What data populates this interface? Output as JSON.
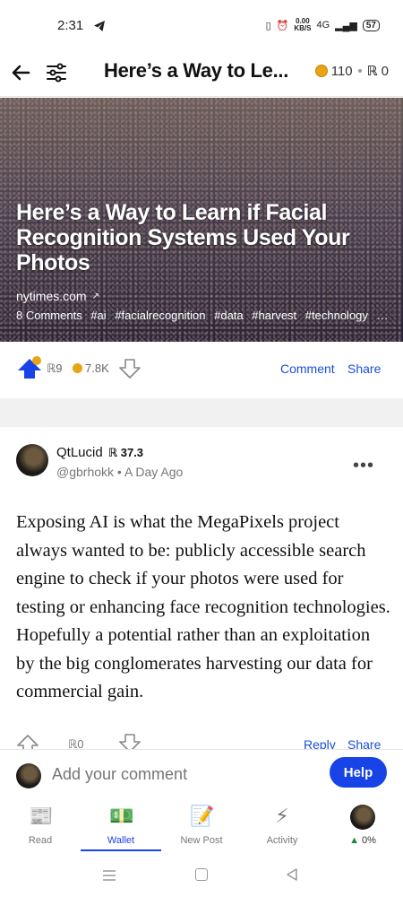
{
  "status_bar": {
    "time": "2:31",
    "net_speed_top": "0.00",
    "net_speed_bottom": "KB/S",
    "network": "4G",
    "battery": "57"
  },
  "header": {
    "title": "Here’s a Way to Le...",
    "coins": "110",
    "r_points": "0"
  },
  "post": {
    "title": "Here’s a Way to Learn if Facial Recognition Systems Used Your Photos",
    "domain": "nytimes.com",
    "comments": "8 Comments",
    "tags": [
      "#ai",
      "#facialrecognition",
      "#data",
      "#harvest",
      "#technology",
      "#..."
    ],
    "r_count": "9",
    "coin_count": "7.8K",
    "comment_label": "Comment",
    "share_label": "Share"
  },
  "comment": {
    "author": "QtLucid",
    "author_score": "37.3",
    "handle": "@gbrhokk",
    "time": "A Day Ago",
    "body": "Exposing AI is what the MegaPixels project always wanted to be: publicly accessible search engine to check if your photos were used for testing or enhancing face recognition technologies. Hopefully a potential rather than an exploitation by the big conglomerates harvesting our data for commercial gain.",
    "r_count": "0",
    "reply_label": "Reply",
    "share_label": "Share"
  },
  "input": {
    "placeholder": "Add your comment",
    "help_label": "Help"
  },
  "nav": {
    "items": [
      {
        "label": "Read",
        "icon": "newspaper-icon"
      },
      {
        "label": "Wallet",
        "icon": "money-icon"
      },
      {
        "label": "New Post",
        "icon": "memo-icon"
      },
      {
        "label": "Activity",
        "icon": "lightning-icon"
      },
      {
        "label": "0%",
        "icon": "avatar"
      }
    ],
    "active": "Wallet"
  },
  "colors": {
    "accent": "#1843e6",
    "link": "#1a4fd6",
    "coin": "#e8a317",
    "upvote": "#1843e6"
  }
}
